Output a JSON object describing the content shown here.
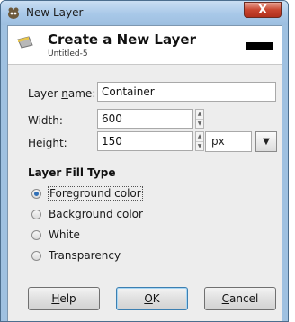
{
  "window": {
    "title": "New Layer",
    "close_label": "X"
  },
  "header": {
    "title": "Create a New Layer",
    "subtitle": "Untitled-5",
    "fill_color": "#000000"
  },
  "form": {
    "name_label": "Layer name:",
    "name_value": "Container",
    "width_label": "Width:",
    "width_value": "600",
    "height_label": "Height:",
    "height_value": "150",
    "unit_value": "px"
  },
  "fill_type": {
    "title": "Layer Fill Type",
    "options": [
      {
        "label": "Foreground color",
        "selected": true
      },
      {
        "label": "Background color",
        "selected": false
      },
      {
        "label": "White",
        "selected": false
      },
      {
        "label": "Transparency",
        "selected": false
      }
    ]
  },
  "buttons": {
    "help": "Help",
    "ok": "OK",
    "cancel": "Cancel"
  },
  "colors": {
    "titlebar": "#a8c8e8",
    "close": "#c8452f",
    "dialog_bg": "#ededed",
    "radio_selected": "#2f6fb6"
  }
}
